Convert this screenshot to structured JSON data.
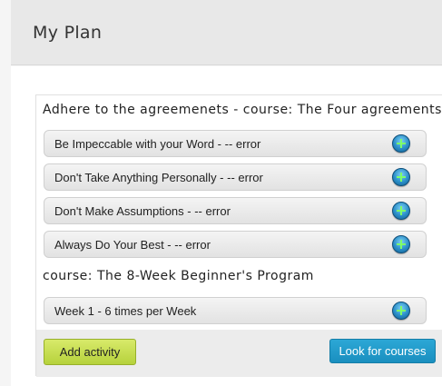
{
  "header": {
    "title": "My Plan"
  },
  "courses": [
    {
      "title": "Adhere to the agreemenets - course: The Four agreements",
      "activities": [
        {
          "label": "Be Impeccable with your Word - -- error",
          "icon": "add-circle-icon"
        },
        {
          "label": "Don't Take Anything Personally - -- error",
          "icon": "add-circle-icon"
        },
        {
          "label": "Don't Make Assumptions - -- error",
          "icon": "add-circle-icon"
        },
        {
          "label": "Always Do Your Best - -- error",
          "icon": "add-circle-icon"
        }
      ]
    },
    {
      "title": "course: The 8-Week Beginner's Program",
      "activities": [
        {
          "label": "Week 1 - 6 times per Week",
          "icon": "add-circle-icon"
        }
      ]
    }
  ],
  "actions": {
    "add_activity": "Add activity",
    "look_for_courses": "Look for courses"
  },
  "colors": {
    "add_button": "#c5de4e",
    "look_button": "#229dcb",
    "icon_blue": "#2a8fc8",
    "icon_plus": "#7dff6a"
  }
}
